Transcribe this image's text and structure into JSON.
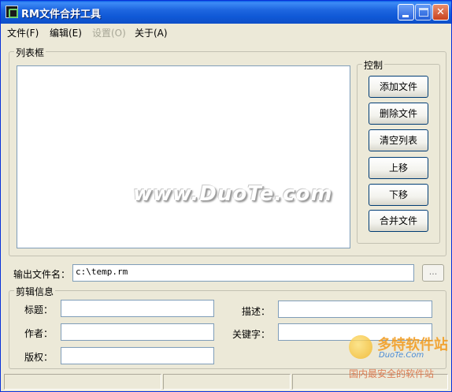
{
  "window": {
    "title": "RM文件合并工具"
  },
  "menu": [
    {
      "label": "文件(F)",
      "enabled": true
    },
    {
      "label": "编辑(E)",
      "enabled": true
    },
    {
      "label": "设置(O)",
      "enabled": false
    },
    {
      "label": "关于(A)",
      "enabled": true
    }
  ],
  "list_group": {
    "title": "列表框"
  },
  "control_group": {
    "title": "控制",
    "buttons": [
      "添加文件",
      "删除文件",
      "清空列表",
      "上移",
      "下移",
      "合并文件"
    ]
  },
  "output": {
    "label": "输出文件名：",
    "value": "c:\\temp.rm",
    "browse_label": "..."
  },
  "clip_info": {
    "title": "剪辑信息",
    "title_label": "标题：",
    "author_label": "作者：",
    "copyright_label": "版权：",
    "desc_label": "描述：",
    "keywords_label": "关键字："
  },
  "watermark": {
    "main": "www.DuoTe.com",
    "corner_brand": "多特软件站",
    "corner_url": "DuoTe.Com",
    "corner_slogan": "国内最安全的软件站"
  },
  "colors": {
    "titlebar": "#0F58D6",
    "face": "#ECE9D8",
    "input_border": "#7F9DB9"
  }
}
